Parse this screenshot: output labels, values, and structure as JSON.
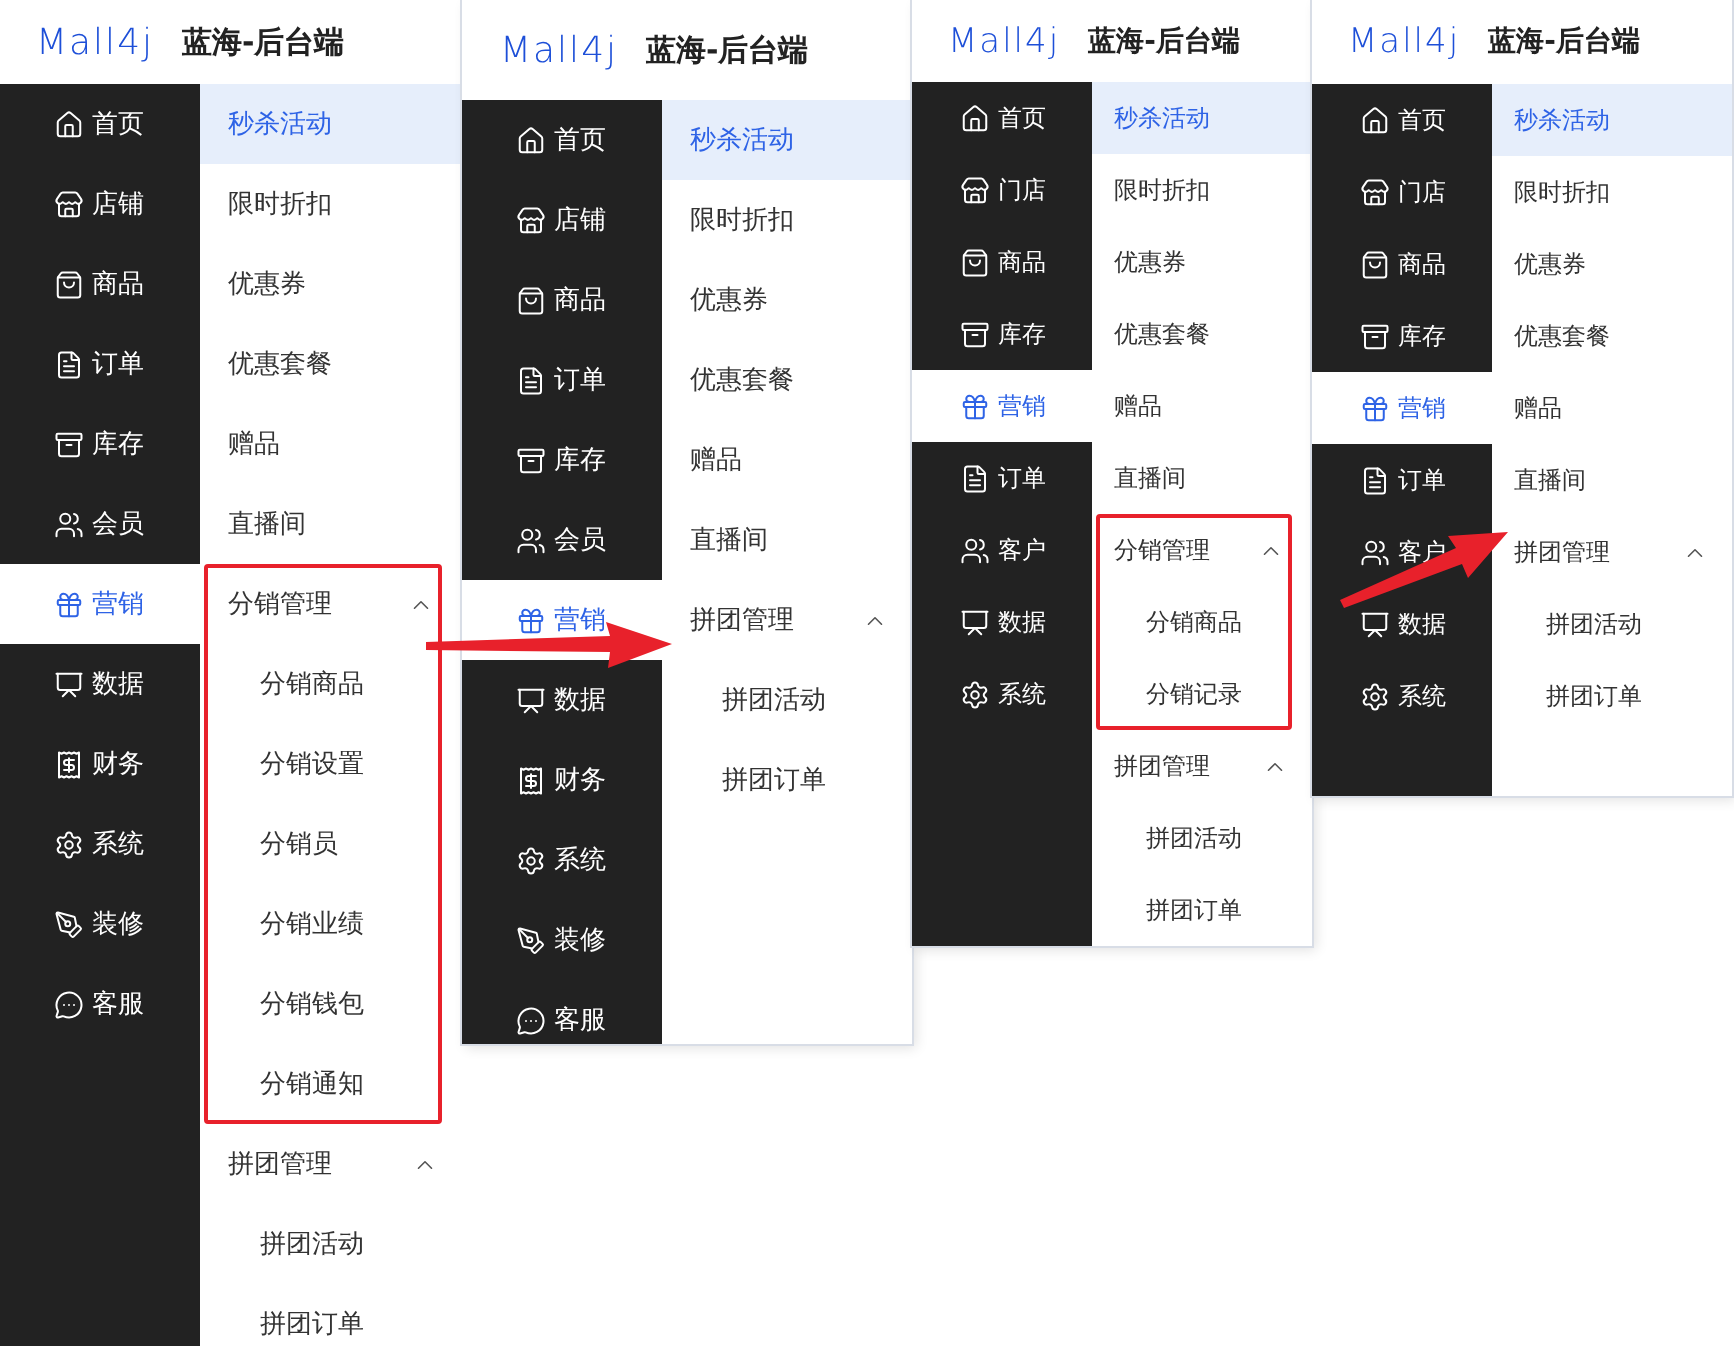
{
  "panels": [
    {
      "logo": "Mall4j",
      "title": "蓝海-后台端",
      "nav": [
        {
          "label": "首页",
          "selected": false
        },
        {
          "label": "店铺",
          "selected": false
        },
        {
          "label": "商品",
          "selected": false
        },
        {
          "label": "订单",
          "selected": false
        },
        {
          "label": "库存",
          "selected": false
        },
        {
          "label": "会员",
          "selected": false
        },
        {
          "label": "营销",
          "selected": true
        },
        {
          "label": "数据",
          "selected": false
        },
        {
          "label": "财务",
          "selected": false
        },
        {
          "label": "系统",
          "selected": false
        },
        {
          "label": "装修",
          "selected": false
        },
        {
          "label": "客服",
          "selected": false
        }
      ],
      "menu": [
        {
          "kind": "link",
          "label": "秒杀活动",
          "selected": true
        },
        {
          "kind": "link",
          "label": "限时折扣",
          "selected": false
        },
        {
          "kind": "link",
          "label": "优惠券",
          "selected": false
        },
        {
          "kind": "link",
          "label": "优惠套餐",
          "selected": false
        },
        {
          "kind": "link",
          "label": "赠品",
          "selected": false
        },
        {
          "kind": "link",
          "label": "直播间",
          "selected": false
        },
        {
          "kind": "group",
          "label": "分销管理",
          "expanded": true,
          "highlighted": true,
          "children": [
            {
              "label": "分销商品",
              "selected": false
            },
            {
              "label": "分销设置",
              "selected": false
            },
            {
              "label": "分销员",
              "selected": false
            },
            {
              "label": "分销业绩",
              "selected": false
            },
            {
              "label": "分销钱包",
              "selected": false
            },
            {
              "label": "分销通知",
              "selected": false
            }
          ]
        },
        {
          "kind": "group",
          "label": "拼团管理",
          "expanded": true,
          "highlighted": false,
          "children": [
            {
              "label": "拼团活动",
              "selected": false
            },
            {
              "label": "拼团订单",
              "selected": false
            }
          ]
        }
      ]
    },
    {
      "logo": "Mall4j",
      "title": "蓝海-后台端",
      "nav": [
        {
          "label": "首页",
          "selected": false
        },
        {
          "label": "店铺",
          "selected": false
        },
        {
          "label": "商品",
          "selected": false
        },
        {
          "label": "订单",
          "selected": false
        },
        {
          "label": "库存",
          "selected": false
        },
        {
          "label": "会员",
          "selected": false
        },
        {
          "label": "营销",
          "selected": true
        },
        {
          "label": "数据",
          "selected": false
        },
        {
          "label": "财务",
          "selected": false
        },
        {
          "label": "系统",
          "selected": false
        },
        {
          "label": "装修",
          "selected": false
        },
        {
          "label": "客服",
          "selected": false
        }
      ],
      "menu": [
        {
          "kind": "link",
          "label": "秒杀活动",
          "selected": true
        },
        {
          "kind": "link",
          "label": "限时折扣",
          "selected": false
        },
        {
          "kind": "link",
          "label": "优惠券",
          "selected": false
        },
        {
          "kind": "link",
          "label": "优惠套餐",
          "selected": false
        },
        {
          "kind": "link",
          "label": "赠品",
          "selected": false
        },
        {
          "kind": "link",
          "label": "直播间",
          "selected": false
        },
        {
          "kind": "group",
          "label": "拼团管理",
          "expanded": true,
          "highlighted": false,
          "children": [
            {
              "label": "拼团活动",
              "selected": false
            },
            {
              "label": "拼团订单",
              "selected": false
            }
          ]
        }
      ]
    },
    {
      "logo": "Mall4j",
      "title": "蓝海-后台端",
      "nav": [
        {
          "label": "首页",
          "selected": false
        },
        {
          "label": "门店",
          "selected": false
        },
        {
          "label": "商品",
          "selected": false
        },
        {
          "label": "库存",
          "selected": false
        },
        {
          "label": "营销",
          "selected": true
        },
        {
          "label": "订单",
          "selected": false
        },
        {
          "label": "客户",
          "selected": false
        },
        {
          "label": "数据",
          "selected": false
        },
        {
          "label": "系统",
          "selected": false
        }
      ],
      "menu": [
        {
          "kind": "link",
          "label": "秒杀活动",
          "selected": true
        },
        {
          "kind": "link",
          "label": "限时折扣",
          "selected": false
        },
        {
          "kind": "link",
          "label": "优惠券",
          "selected": false
        },
        {
          "kind": "link",
          "label": "优惠套餐",
          "selected": false
        },
        {
          "kind": "link",
          "label": "赠品",
          "selected": false
        },
        {
          "kind": "link",
          "label": "直播间",
          "selected": false
        },
        {
          "kind": "group",
          "label": "分销管理",
          "expanded": true,
          "highlighted": true,
          "children": [
            {
              "label": "分销商品",
              "selected": false
            },
            {
              "label": "分销记录",
              "selected": false
            }
          ]
        },
        {
          "kind": "group",
          "label": "拼团管理",
          "expanded": true,
          "highlighted": false,
          "children": [
            {
              "label": "拼团活动",
              "selected": false
            },
            {
              "label": "拼团订单",
              "selected": false
            }
          ]
        }
      ]
    },
    {
      "logo": "Mall4j",
      "title": "蓝海-后台端",
      "nav": [
        {
          "label": "首页",
          "selected": false
        },
        {
          "label": "门店",
          "selected": false
        },
        {
          "label": "商品",
          "selected": false
        },
        {
          "label": "库存",
          "selected": false
        },
        {
          "label": "营销",
          "selected": true
        },
        {
          "label": "订单",
          "selected": false
        },
        {
          "label": "客户",
          "selected": false
        },
        {
          "label": "数据",
          "selected": false
        },
        {
          "label": "系统",
          "selected": false
        }
      ],
      "menu": [
        {
          "kind": "link",
          "label": "秒杀活动",
          "selected": true
        },
        {
          "kind": "link",
          "label": "限时折扣",
          "selected": false
        },
        {
          "kind": "link",
          "label": "优惠券",
          "selected": false
        },
        {
          "kind": "link",
          "label": "优惠套餐",
          "selected": false
        },
        {
          "kind": "link",
          "label": "赠品",
          "selected": false
        },
        {
          "kind": "link",
          "label": "直播间",
          "selected": false
        },
        {
          "kind": "group",
          "label": "拼团管理",
          "expanded": true,
          "highlighted": false,
          "children": [
            {
              "label": "拼团活动",
              "selected": false
            },
            {
              "label": "拼团订单",
              "selected": false
            }
          ]
        }
      ]
    }
  ]
}
